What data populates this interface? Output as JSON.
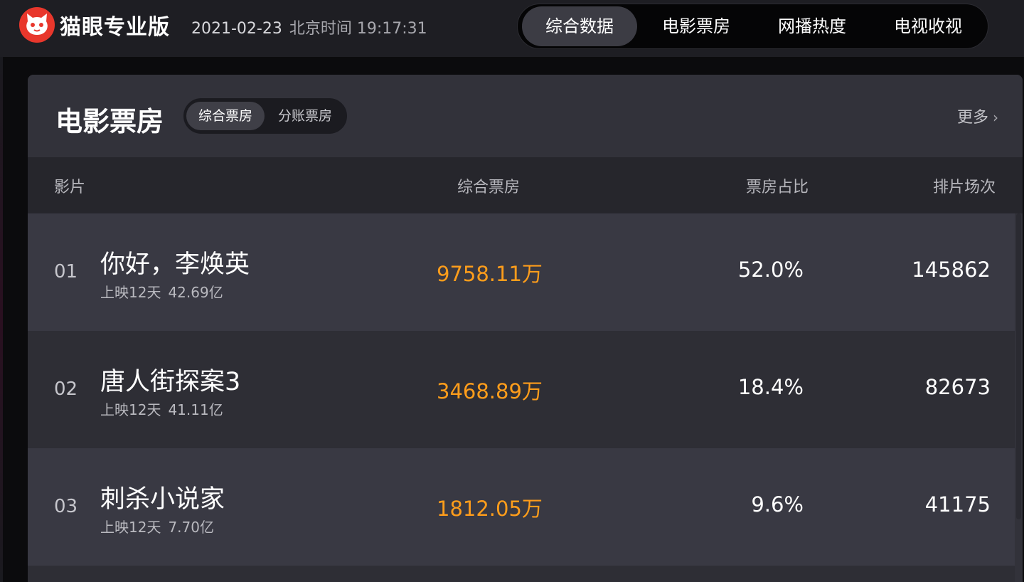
{
  "header": {
    "brand": "猫眼专业版",
    "date": "2021-02-23",
    "time": "北京时间 19:17:31",
    "nav_tabs": [
      {
        "label": "综合数据",
        "active": true
      },
      {
        "label": "电影票房",
        "active": false
      },
      {
        "label": "网播热度",
        "active": false
      },
      {
        "label": "电视收视",
        "active": false
      }
    ]
  },
  "panel": {
    "title": "电影票房",
    "segments": [
      {
        "label": "综合票房",
        "active": true
      },
      {
        "label": "分账票房",
        "active": false
      }
    ],
    "more_label": "更多",
    "columns": [
      "影片",
      "综合票房",
      "票房占比",
      "排片场次"
    ],
    "rows": [
      {
        "rank": "01",
        "title": "你好，李焕英",
        "days": "上映12天",
        "total": "42.69亿",
        "gross": "9758.11万",
        "share": "52.0%",
        "shows": "145862"
      },
      {
        "rank": "02",
        "title": "唐人街探案3",
        "days": "上映12天",
        "total": "41.11亿",
        "gross": "3468.89万",
        "share": "18.4%",
        "shows": "82673"
      },
      {
        "rank": "03",
        "title": "刺杀小说家",
        "days": "上映12天",
        "total": "7.70亿",
        "gross": "1812.05万",
        "share": "9.6%",
        "shows": "41175"
      }
    ]
  },
  "colors": {
    "accent_orange": "#ff9d1b",
    "logo_red": "#e8372c",
    "panel_bg": "#32323a"
  }
}
